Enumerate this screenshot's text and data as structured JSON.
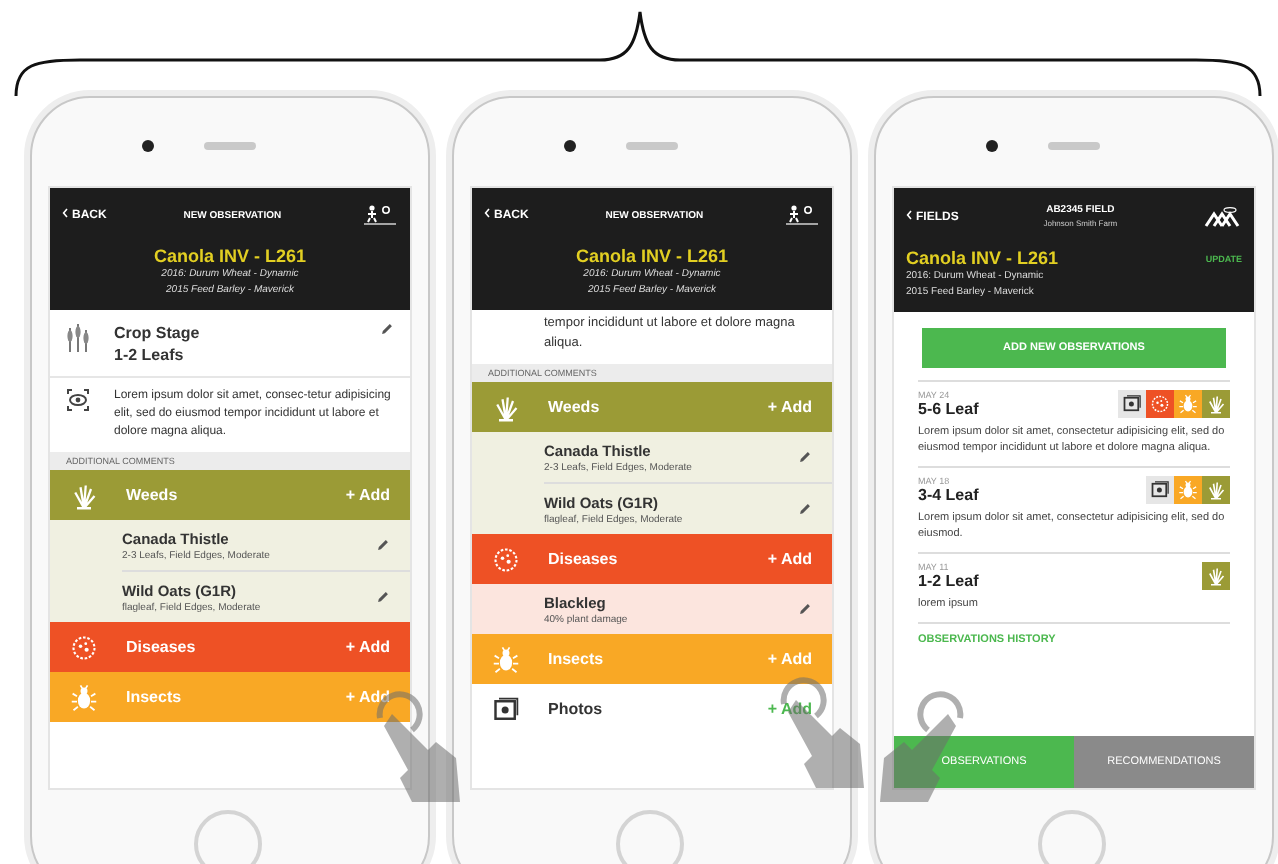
{
  "phones": [
    {
      "kind": "observation",
      "header": {
        "back": "BACK",
        "title": "NEW OBSERVATION",
        "crop": "Canola INV - L261",
        "history": [
          "2016: Durum Wheat - Dynamic",
          "2015 Feed Barley - Maverick"
        ]
      },
      "crop_stage": {
        "label": "Crop Stage",
        "value": "1-2 Leafs"
      },
      "note": "Lorem ipsum dolor sit amet, consec-tetur adipisicing elit, sed do eiusmod tempor incididunt ut labore et dolore magna aliqua.",
      "section_label": "ADDITIONAL COMMENTS",
      "categories": [
        {
          "kind": "weeds",
          "name": "Weeds",
          "color": "#9b9b36",
          "add": "+ Add",
          "entries": [
            {
              "name": "Canada Thistle",
              "detail": "2-3 Leafs, Field Edges, Moderate"
            },
            {
              "name": "Wild Oats (G1R)",
              "detail": "flagleaf, Field Edges, Moderate"
            }
          ]
        },
        {
          "kind": "diseases",
          "name": "Diseases",
          "color": "#ee5125",
          "add": "+ Add"
        },
        {
          "kind": "insects",
          "name": "Insects",
          "color": "#f9a825",
          "add": "+ Add"
        }
      ]
    },
    {
      "kind": "observation",
      "header": {
        "back": "BACK",
        "title": "NEW OBSERVATION",
        "crop": "Canola INV - L261",
        "history": [
          "2016: Durum Wheat - Dynamic",
          "2015 Feed Barley - Maverick"
        ]
      },
      "note": "tempor incididunt ut labore et dolore magna aliqua.",
      "section_label": "ADDITIONAL COMMENTS",
      "categories": [
        {
          "kind": "weeds",
          "name": "Weeds",
          "color": "#9b9b36",
          "add": "+ Add",
          "entries": [
            {
              "name": "Canada Thistle",
              "detail": "2-3 Leafs, Field Edges, Moderate"
            },
            {
              "name": "Wild Oats (G1R)",
              "detail": "flagleaf, Field Edges, Moderate"
            }
          ]
        },
        {
          "kind": "diseases",
          "name": "Diseases",
          "color": "#ee5125",
          "add": "+ Add",
          "entries": [
            {
              "name": "Blackleg",
              "detail": "40% plant damage"
            }
          ]
        },
        {
          "kind": "insects",
          "name": "Insects",
          "color": "#f9a825",
          "add": "+ Add"
        },
        {
          "kind": "photos",
          "name": "Photos",
          "add": "+ Add"
        }
      ]
    },
    {
      "kind": "field",
      "header": {
        "back": "FIELDS",
        "title": "AB2345 FIELD",
        "subtitle": "Johnson Smith Farm",
        "crop": "Canola INV - L261",
        "action": "UPDATE",
        "history": [
          "2016: Durum Wheat - Dynamic",
          "2015 Feed Barley - Maverick"
        ]
      },
      "primary_button": "ADD NEW OBSERVATIONS",
      "observations": [
        {
          "date": "MAY 24",
          "stage": "5-6 Leaf",
          "tags": [
            {
              "kind": "photos",
              "color": "#e6e6e6"
            },
            {
              "kind": "diseases",
              "color": "#ee5125"
            },
            {
              "kind": "insects",
              "color": "#f9a825"
            },
            {
              "kind": "weeds",
              "color": "#9b9b36"
            }
          ],
          "text": "Lorem ipsum dolor sit amet, consectetur adipisicing elit, sed do eiusmod tempor incididunt ut labore et dolore magna aliqua."
        },
        {
          "date": "MAY 18",
          "stage": "3-4 Leaf",
          "tags": [
            {
              "kind": "photos",
              "color": "#e6e6e6"
            },
            {
              "kind": "insects",
              "color": "#f9a825"
            },
            {
              "kind": "weeds",
              "color": "#9b9b36"
            }
          ],
          "text": "Lorem ipsum dolor sit amet, consectetur adipisicing elit, sed do eiusmod."
        },
        {
          "date": "MAY 11",
          "stage": "1-2 Leaf",
          "tags": [
            {
              "kind": "weeds",
              "color": "#9b9b36"
            }
          ],
          "text": "lorem ipsum"
        }
      ],
      "history_link": "OBSERVATIONS HISTORY",
      "tabs": [
        {
          "label": "OBSERVATIONS",
          "selected": true
        },
        {
          "label": "RECOMMENDATIONS",
          "selected": false
        }
      ]
    }
  ]
}
